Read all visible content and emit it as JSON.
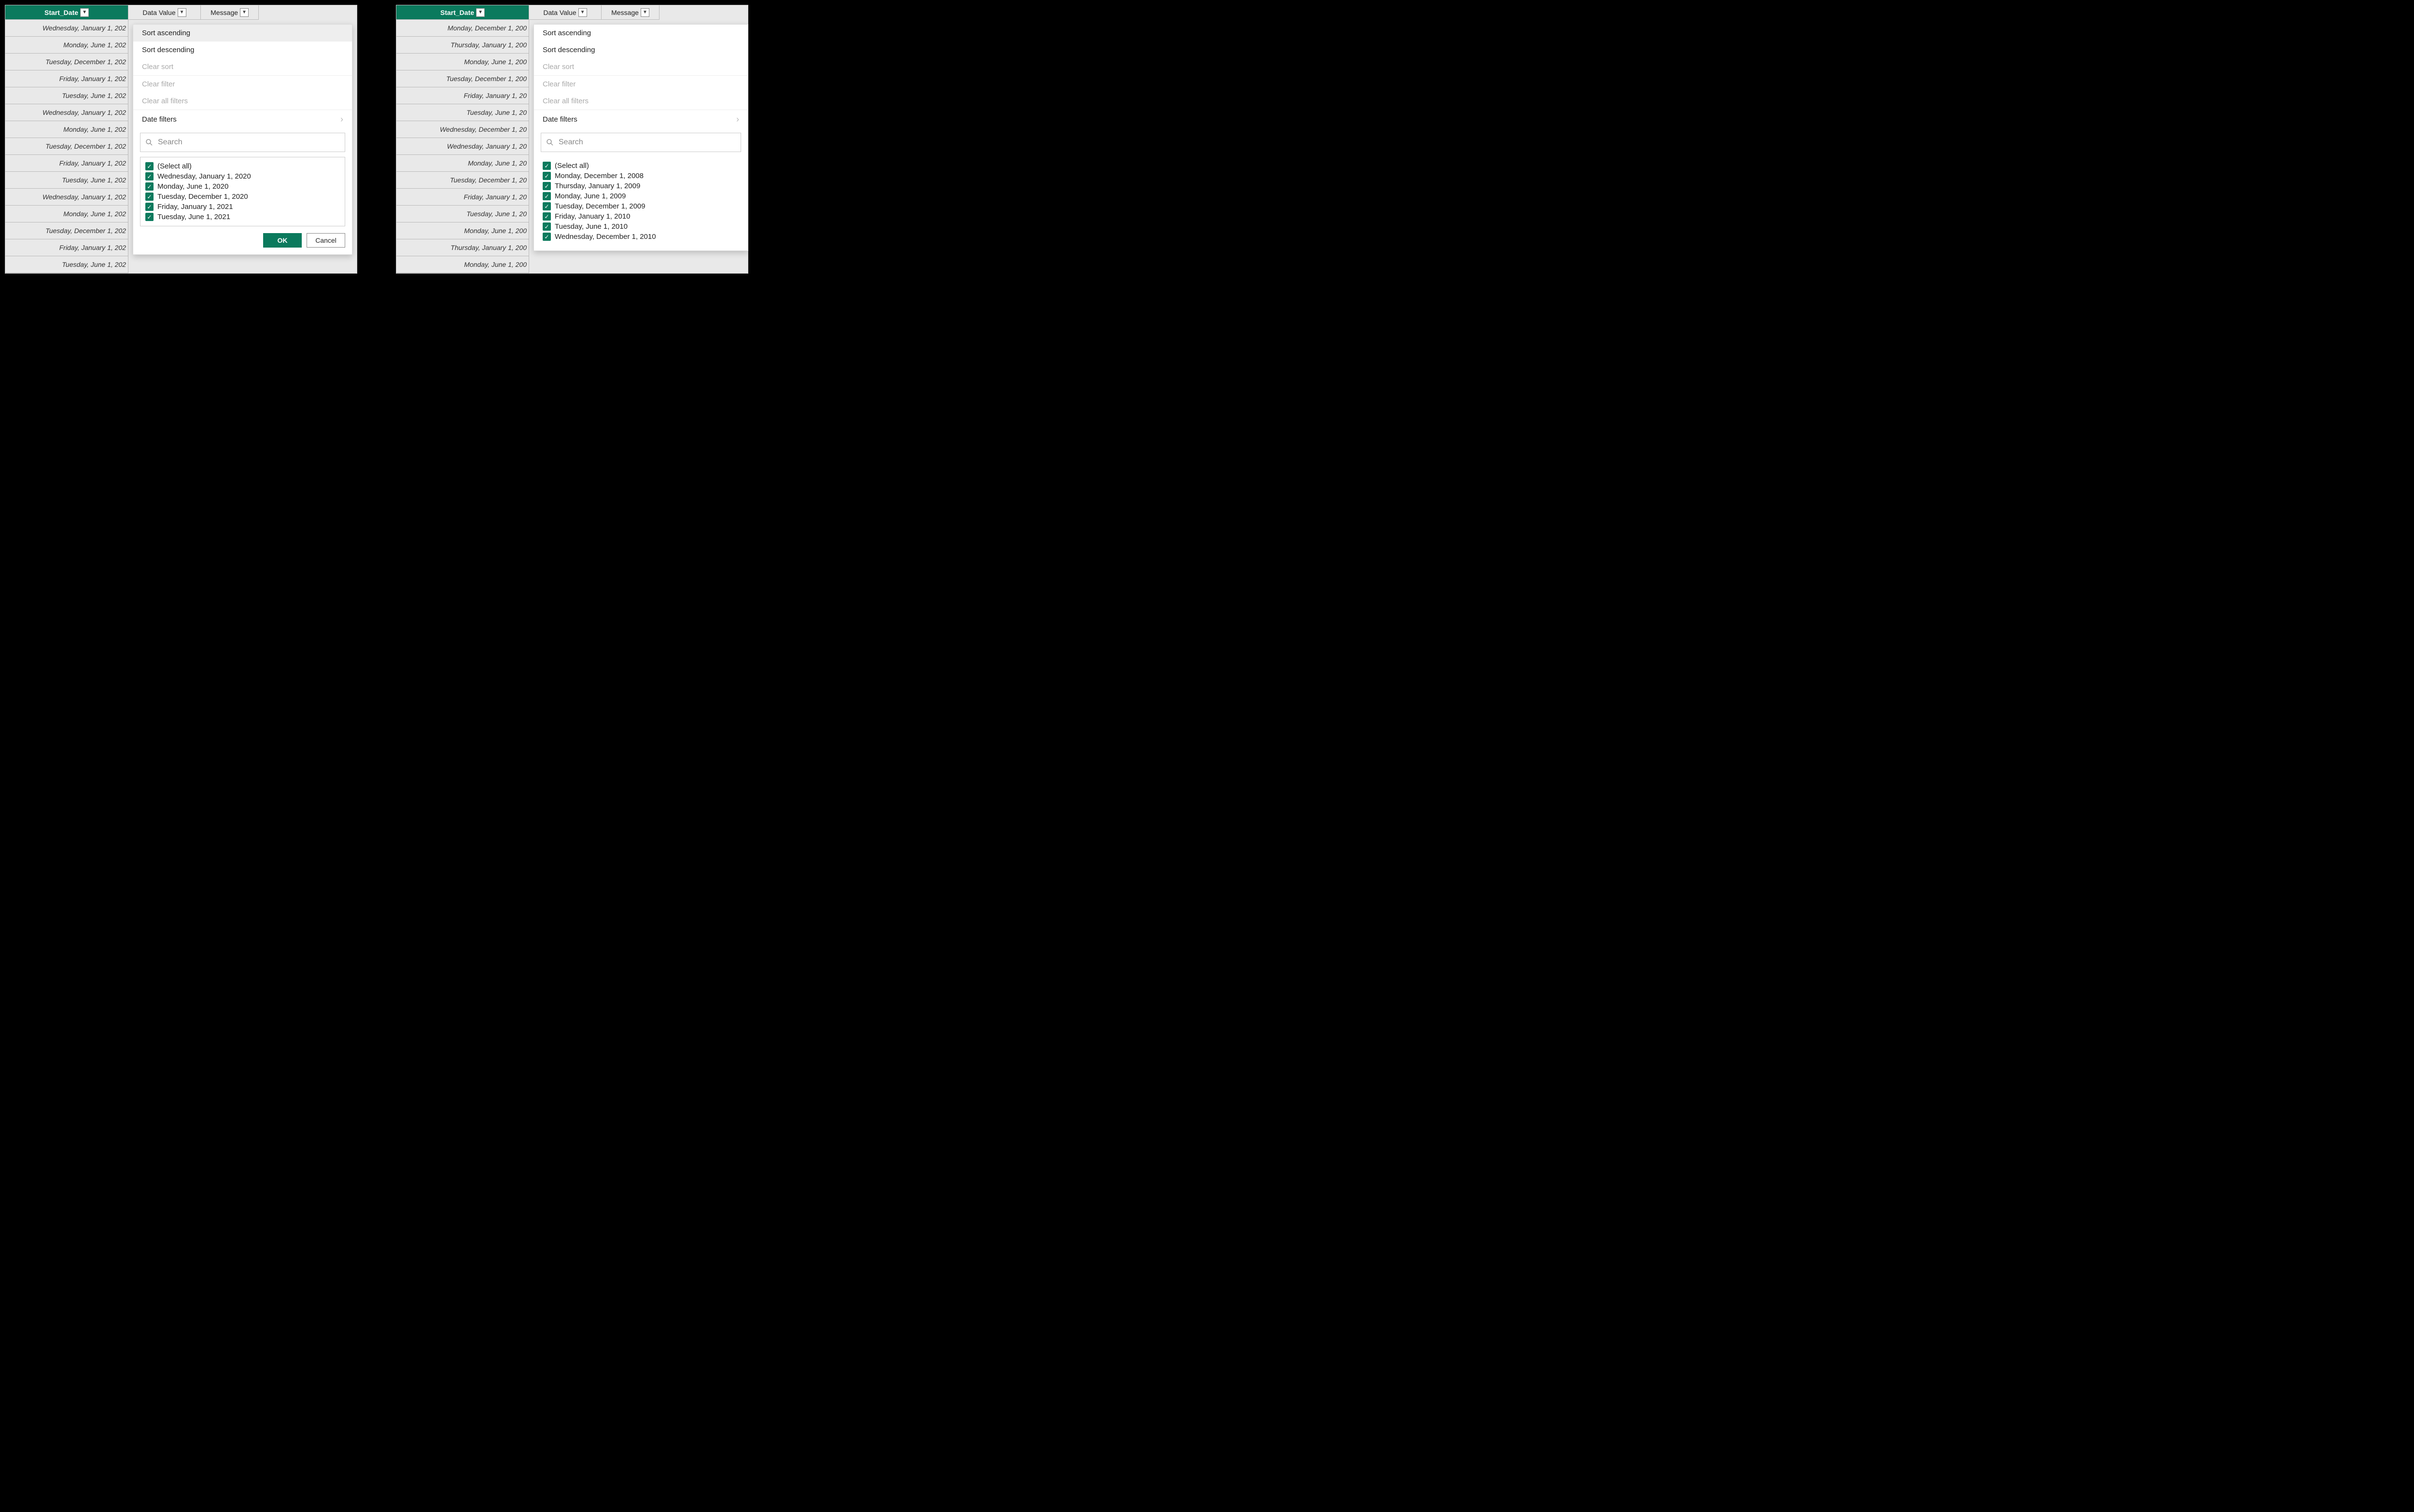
{
  "colors": {
    "accent": "#0b7a5d"
  },
  "headers": {
    "date": "Start_Date",
    "value": "Data Value",
    "msg": "Message"
  },
  "menu": {
    "sort_asc": "Sort ascending",
    "sort_desc": "Sort descending",
    "clear_sort": "Clear sort",
    "clear_filter": "Clear filter",
    "clear_all": "Clear all filters",
    "date_filters": "Date filters",
    "search_placeholder": "Search",
    "select_all": "(Select all)",
    "ok": "OK",
    "cancel": "Cancel"
  },
  "left": {
    "rows": [
      "Wednesday, January 1, 202",
      "Monday, June 1, 202",
      "Tuesday, December 1, 202",
      "Friday, January 1, 202",
      "Tuesday, June 1, 202",
      "Wednesday, January 1, 202",
      "Monday, June 1, 202",
      "Tuesday, December 1, 202",
      "Friday, January 1, 202",
      "Tuesday, June 1, 202",
      "Wednesday, January 1, 202",
      "Monday, June 1, 202",
      "Tuesday, December 1, 202",
      "Friday, January 1, 202",
      "Tuesday, June 1, 202"
    ],
    "options": [
      "Wednesday, January 1, 2020",
      "Monday, June 1, 2020",
      "Tuesday, December 1, 2020",
      "Friday, January 1, 2021",
      "Tuesday, June 1, 2021"
    ]
  },
  "right": {
    "rows": [
      "Monday, December 1, 200",
      "Thursday, January 1, 200",
      "Monday, June 1, 200",
      "Tuesday, December 1, 200",
      "Friday, January 1, 20",
      "Tuesday, June 1, 20",
      "Wednesday, December 1, 20",
      "Wednesday, January 1, 20",
      "Monday, June 1, 20",
      "Tuesday, December 1, 20",
      "Friday, January 1, 20",
      "Tuesday, June 1, 20",
      "Monday, June 1, 200",
      "Thursday, January 1, 200",
      "Monday, June 1, 200"
    ],
    "options": [
      "Monday, December 1, 2008",
      "Thursday, January 1, 2009",
      "Monday, June 1, 2009",
      "Tuesday, December 1, 2009",
      "Friday, January 1, 2010",
      "Tuesday, June 1, 2010",
      "Wednesday, December 1, 2010"
    ]
  }
}
